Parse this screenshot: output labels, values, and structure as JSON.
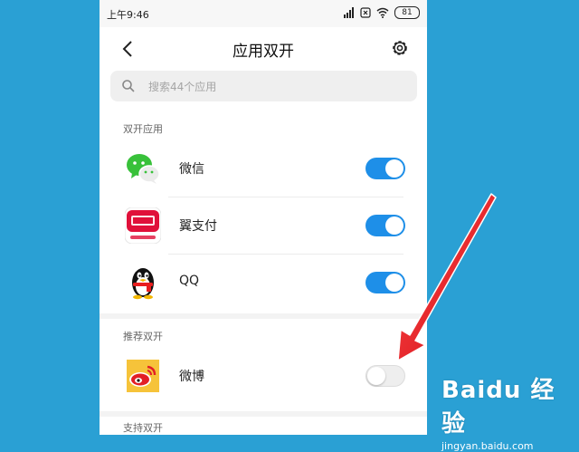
{
  "status_bar": {
    "time": "上午9:46",
    "battery": "81"
  },
  "header": {
    "title": "应用双开"
  },
  "search": {
    "placeholder": "搜索44个应用"
  },
  "sections": {
    "enabled": "双开应用",
    "recommended": "推荐双开",
    "supported": "支持双开"
  },
  "apps_enabled": [
    {
      "name": "微信",
      "icon": "wechat-icon",
      "on": true
    },
    {
      "name": "翼支付",
      "icon": "bestpay-icon",
      "on": true
    },
    {
      "name": "QQ",
      "icon": "qq-penguin-icon",
      "on": true
    }
  ],
  "apps_recommended": [
    {
      "name": "微博",
      "icon": "weibo-icon",
      "on": false
    }
  ],
  "watermark": {
    "main": "Baidu 经验",
    "sub": "jingyan.baidu.com"
  },
  "colors": {
    "accent": "#1e8fe8",
    "annotation": "#e8141c",
    "background": "#2aa0d4"
  }
}
